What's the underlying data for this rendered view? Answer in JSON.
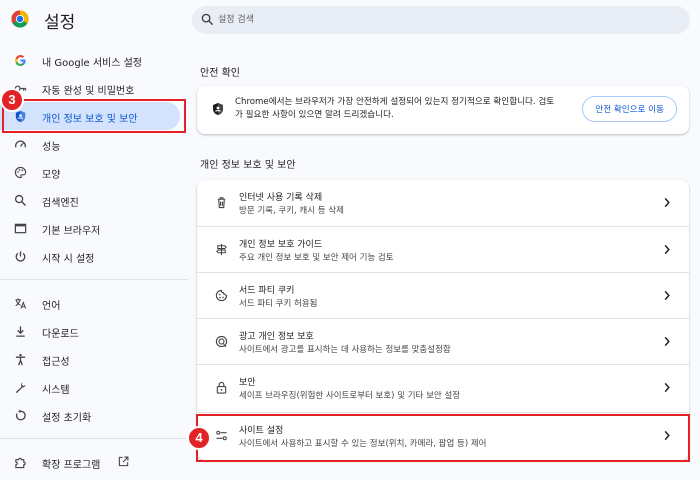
{
  "app": {
    "title": "설정"
  },
  "search": {
    "placeholder": "설정 검색"
  },
  "sidebar": {
    "items": [
      {
        "label": "내 Google 서비스 설정",
        "icon": "google-icon"
      },
      {
        "label": "자동 완성 및 비밀번호",
        "icon": "autofill-icon"
      },
      {
        "label": "개인 정보 보호 및 보안",
        "icon": "shield-icon",
        "active": true
      },
      {
        "label": "성능",
        "icon": "speedometer-icon"
      },
      {
        "label": "모양",
        "icon": "palette-icon"
      },
      {
        "label": "검색엔진",
        "icon": "search-icon"
      },
      {
        "label": "기본 브라우저",
        "icon": "browser-window-icon"
      },
      {
        "label": "시작 시 설정",
        "icon": "power-icon"
      },
      {
        "label": "언어",
        "icon": "translate-icon"
      },
      {
        "label": "다운로드",
        "icon": "download-icon"
      },
      {
        "label": "접근성",
        "icon": "accessibility-icon"
      },
      {
        "label": "시스템",
        "icon": "wrench-icon"
      },
      {
        "label": "설정 초기화",
        "icon": "reset-icon"
      },
      {
        "label": "확장 프로그램",
        "icon": "extension-icon"
      }
    ]
  },
  "annotations": {
    "badge_3": "3",
    "badge_4": "4",
    "highlight_color": "#e32227"
  },
  "safety_check": {
    "section_title": "안전 확인",
    "description": "Chrome에서는 브라우저가 가장 안전하게 설정되어 있는지 정기적으로 확인합니다. 검토가 필요한 사항이 있으면 알려 드리겠습니다.",
    "button_label": "안전 확인으로 이동"
  },
  "privacy": {
    "section_title": "개인 정보 보호 및 보안",
    "rows": [
      {
        "title": "인터넷 사용 기록 삭제",
        "subtitle": "방문 기록, 쿠키, 캐시 등 삭제",
        "icon": "trash-icon"
      },
      {
        "title": "개인 정보 보호 가이드",
        "subtitle": "주요 개인 정보 보호 및 보안 제어 기능 검토",
        "icon": "guide-icon"
      },
      {
        "title": "서드 파티 쿠키",
        "subtitle": "서드 파티 쿠키 허용됨",
        "icon": "cookie-icon"
      },
      {
        "title": "광고 개인 정보 보호",
        "subtitle": "사이트에서 광고를 표시하는 데 사용하는 정보를 맞춤설정함",
        "icon": "ad-privacy-icon"
      },
      {
        "title": "보안",
        "subtitle": "세이프 브라우징(위험한 사이트로부터 보호) 및 기타 보안 설정",
        "icon": "lock-icon"
      },
      {
        "title": "사이트 설정",
        "subtitle": "사이트에서 사용하고 표시할 수 있는 정보(위치, 카메라, 팝업 등) 제어",
        "icon": "sliders-icon"
      }
    ]
  },
  "colors": {
    "accent": "#0b57d0",
    "active_bg": "#d3e3fd",
    "background": "#f8fafd"
  }
}
